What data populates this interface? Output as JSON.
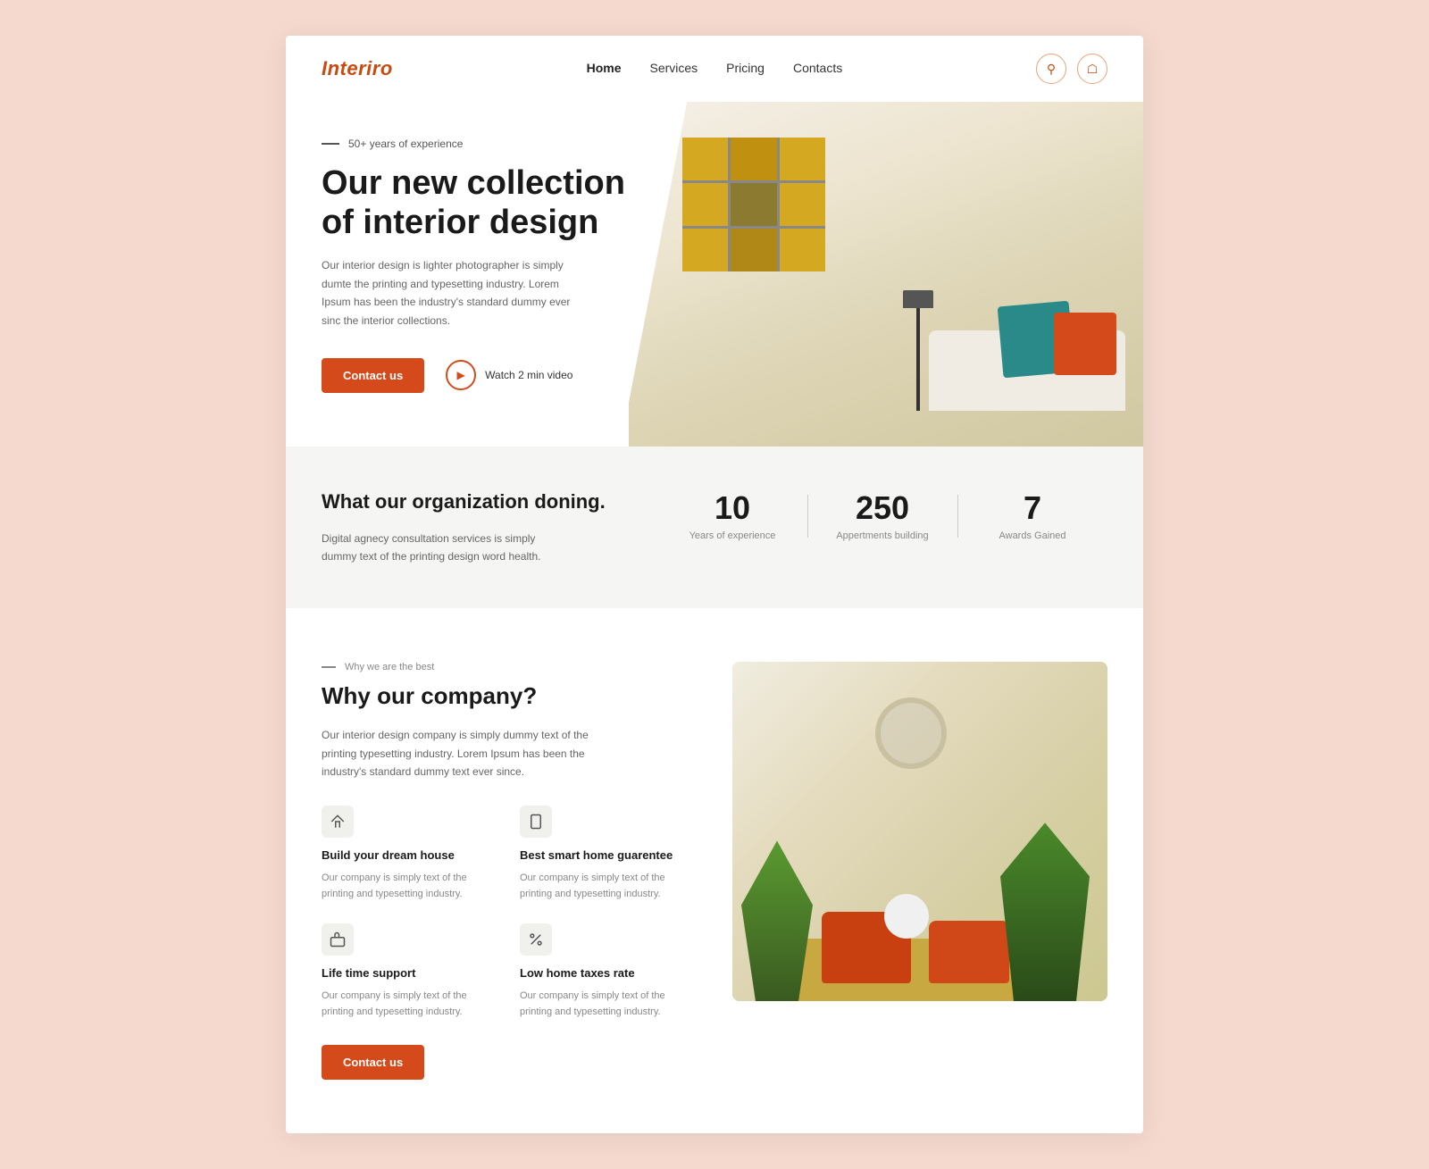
{
  "brand": {
    "logo": "Interiro"
  },
  "navbar": {
    "links": [
      {
        "label": "Home",
        "active": true
      },
      {
        "label": "Services",
        "active": false
      },
      {
        "label": "Pricing",
        "active": false
      },
      {
        "label": "Contacts",
        "active": false
      }
    ],
    "search_icon": "🔍",
    "user_icon": "👤"
  },
  "hero": {
    "tagline": "50+ years of experience",
    "title": "Our new collection of interior design",
    "description": "Our interior design is lighter photographer is simply dumte the printing and typesetting industry. Lorem Ipsum has been the industry's standard dummy ever sinc the interior collections.",
    "contact_btn": "Contact us",
    "watch_btn": "Watch 2 min video"
  },
  "stats": {
    "heading": "What our organization doning.",
    "description": "Digital agnecy consultation services is simply dummy text of the printing design word health.",
    "items": [
      {
        "number": "10",
        "label": "Years of\nexperience"
      },
      {
        "number": "250",
        "label": "Appertments\nbuilding"
      },
      {
        "number": "7",
        "label": "Awards\nGained"
      }
    ]
  },
  "why": {
    "tag": "Why we are the best",
    "title": "Why our company?",
    "description": "Our interior design company is simply dummy text of the printing typesetting industry. Lorem Ipsum has been the industry's standard dummy text ever since.",
    "features": [
      {
        "icon": "🏠",
        "name": "Build your dream house",
        "description": "Our company is simply text of the printing and typesetting industry."
      },
      {
        "icon": "📱",
        "name": "Best smart home guarentee",
        "description": "Our company is simply text of the printing and typesetting industry."
      },
      {
        "icon": "👍",
        "name": "Life time support",
        "description": "Our company is simply text of the printing and typesetting industry."
      },
      {
        "icon": "%",
        "name": "Low home taxes rate",
        "description": "Our company is simply text of the printing and typesetting industry."
      }
    ],
    "contact_btn": "Contact us"
  }
}
